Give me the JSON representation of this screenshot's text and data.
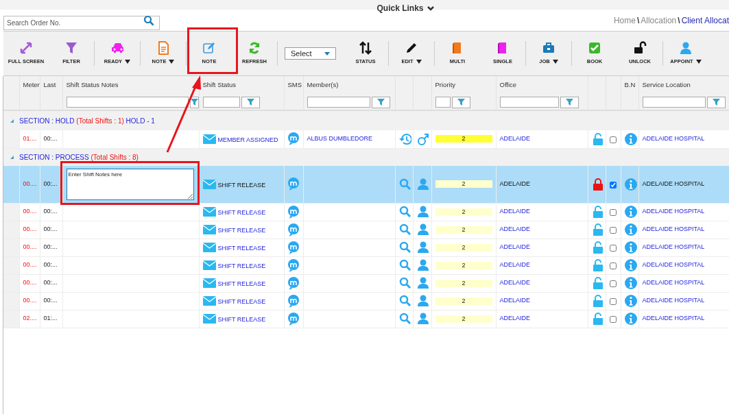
{
  "quick_links": "Quick Links",
  "search": {
    "placeholder": "Search Order No."
  },
  "breadcrumb": [
    {
      "kind": "link",
      "label": "Home",
      "selected": false
    },
    {
      "kind": "separator",
      "label": "\\",
      "selected": false
    },
    {
      "kind": "link",
      "label": "Allocation",
      "selected": false
    },
    {
      "kind": "separator",
      "label": "\\",
      "selected": false
    },
    {
      "kind": "link",
      "label": "Client Allocat",
      "selected": true
    }
  ],
  "toolbar": [
    [
      {
        "kind": "fullscreen",
        "label": "FULL SCREEN",
        "caret": false
      },
      {
        "kind": "filter",
        "label": "FILTER",
        "caret": false
      }
    ],
    [
      {
        "kind": "car",
        "label": "READY",
        "caret": true
      }
    ],
    [
      {
        "kind": "doc",
        "label": "NOTE",
        "caret": true
      }
    ],
    [
      {
        "kind": "edit",
        "label": "NOTE",
        "caret": false
      },
      {
        "kind": "refresh",
        "label": "REFRESH",
        "caret": false
      }
    ],
    [
      {
        "kind": "select",
        "label": "Select",
        "caret": true
      },
      {
        "kind": "sort",
        "label": "STATUS",
        "caret": false
      }
    ],
    [
      {
        "kind": "pencil",
        "label": "EDIT",
        "caret": true
      }
    ],
    [
      {
        "kind": "book",
        "label": "MULTI",
        "caret": false
      },
      {
        "kind": "book2",
        "label": "SINGLE",
        "caret": false
      }
    ],
    [
      {
        "kind": "briefcase",
        "label": "JOB",
        "caret": true
      }
    ],
    [
      {
        "kind": "check",
        "label": "BOOK",
        "caret": false
      },
      {
        "kind": "unlock",
        "label": "UNLOCK",
        "caret": false
      }
    ],
    [
      {
        "kind": "user",
        "label": "APPOINT",
        "caret": true
      }
    ]
  ],
  "columns": [
    {
      "filter": false
    },
    {
      "label": "Meter",
      "filter": false
    },
    {
      "label": "Last",
      "filter": false
    },
    {
      "label": "Shift Status Notes",
      "filter": true
    },
    {
      "label": "Shift Status",
      "filter": true
    },
    {
      "label": "SMS",
      "filter": false
    },
    {
      "label": "Member(s)",
      "filter": true
    },
    {
      "filter": false
    },
    {
      "filter": false
    },
    {
      "label": "Priority",
      "filter": true
    },
    {
      "label": "Office",
      "filter": true
    },
    {
      "filter": false
    },
    {
      "filter": false
    },
    {
      "label": "B.N",
      "filter": false
    },
    {
      "label": "Service Location",
      "filter": true
    }
  ],
  "sections": [
    {
      "title": "SECTION : HOLD",
      "total": "(Total Shifts : 1)",
      "suffix": "HOLD - 1",
      "rows": [
        {
          "meter": "01....",
          "last": "00:...",
          "status": "MEMBER ASSIGNED",
          "member": "ALBUS DUMBLEDORE",
          "kind": "assigned",
          "priority": "2",
          "color": "#ffff33",
          "office": "ADELAIDE",
          "locked": false,
          "checked": false,
          "location": "ADELAIDE HOSPITAL",
          "selected": false
        }
      ]
    },
    {
      "title": "SECTION : PROCESS",
      "total": "(Total Shifts : 8)",
      "rows": [
        {
          "meter": "00....",
          "last": "00:...",
          "notes_placeholder": "Enter Shift Notes here",
          "status": "SHIFT RELEASE",
          "kind": "open",
          "priority": "2",
          "color": "#ffffcc",
          "office": "ADELAIDE",
          "locked": true,
          "checked": true,
          "location": "ADELAIDE HOSPITAL",
          "selected": true
        },
        {
          "meter": "00....",
          "last": "00:...",
          "status": "SHIFT RELEASE",
          "kind": "open",
          "priority": "2",
          "color": "#ffffcc",
          "office": "ADELAIDE",
          "locked": false,
          "checked": false,
          "location": "ADELAIDE HOSPITAL",
          "selected": false
        },
        {
          "meter": "00....",
          "last": "00:...",
          "status": "SHIFT RELEASE",
          "kind": "open",
          "priority": "2",
          "color": "#ffffcc",
          "office": "ADELAIDE",
          "locked": false,
          "checked": false,
          "location": "ADELAIDE HOSPITAL",
          "selected": false
        },
        {
          "meter": "00....",
          "last": "00:...",
          "status": "SHIFT RELEASE",
          "kind": "open",
          "priority": "2",
          "color": "#ffffcc",
          "office": "ADELAIDE",
          "locked": false,
          "checked": false,
          "location": "ADELAIDE HOSPITAL",
          "selected": false
        },
        {
          "meter": "00....",
          "last": "00:...",
          "status": "SHIFT RELEASE",
          "kind": "open",
          "priority": "2",
          "color": "#ffffcc",
          "office": "ADELAIDE",
          "locked": false,
          "checked": false,
          "location": "ADELAIDE HOSPITAL",
          "selected": false
        },
        {
          "meter": "00....",
          "last": "00:...",
          "status": "SHIFT RELEASE",
          "kind": "open",
          "priority": "2",
          "color": "#ffffcc",
          "office": "ADELAIDE",
          "locked": false,
          "checked": false,
          "location": "ADELAIDE HOSPITAL",
          "selected": false
        },
        {
          "meter": "00....",
          "last": "00:...",
          "status": "SHIFT RELEASE",
          "kind": "open",
          "priority": "2",
          "color": "#ffffcc",
          "office": "ADELAIDE",
          "locked": false,
          "checked": false,
          "location": "ADELAIDE HOSPITAL",
          "selected": false
        },
        {
          "meter": "02....",
          "last": "01:...",
          "status": "SHIFT RELEASE",
          "kind": "open",
          "priority": "2",
          "color": "#ffffcc",
          "office": "ADELAIDE",
          "locked": false,
          "checked": false,
          "location": "ADELAIDE HOSPITAL",
          "selected": false
        }
      ]
    }
  ]
}
